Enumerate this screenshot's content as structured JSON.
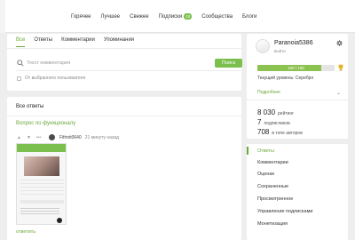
{
  "nav": {
    "items": [
      {
        "label": "Горячее"
      },
      {
        "label": "Лучшее"
      },
      {
        "label": "Свежее"
      },
      {
        "label": "Подписки",
        "badge": "18"
      },
      {
        "label": "Сообщества"
      },
      {
        "label": "Блоги"
      }
    ]
  },
  "tabs": [
    "Все",
    "Ответы",
    "Комментарии",
    "Упоминания"
  ],
  "search": {
    "placeholder": "Текст комментария",
    "button_label": "Поиск",
    "user_filter_label": "От выбранного пользователя"
  },
  "answers": {
    "header": "Все ответы",
    "question_title": "Вопрос по функционалу",
    "author": "Fifrinit0640",
    "time_ago": "21 минуту назад",
    "reply_label": "ответить"
  },
  "profile": {
    "username": "Paranoia5386",
    "logout_label": "выйти",
    "progress_text": "150 / 180",
    "progress_fraction": 0.8333,
    "level_text": "Текущий уровень: Серебро",
    "details_label": "Подробнее",
    "stats": [
      {
        "value": "8 030",
        "label": "рейтинг"
      },
      {
        "value": "7",
        "label": "подписчиков"
      },
      {
        "value": "708",
        "label": "в топе авторов"
      }
    ]
  },
  "menu": {
    "items": [
      {
        "label": "Ответы",
        "active": true
      },
      {
        "label": "Комментарии"
      },
      {
        "label": "Оценки"
      },
      {
        "label": "Сохраненные"
      },
      {
        "label": "Просмотренное"
      },
      {
        "label": "Управление подписками"
      },
      {
        "label": "Монетизация"
      }
    ]
  },
  "colors": {
    "accent": "#6aa83b",
    "button": "#7bbf4e",
    "progress": "#8cc24f"
  },
  "icons": [
    "search-icon",
    "gear-icon",
    "trophy-icon",
    "chevron-down-icon",
    "upvote-icon",
    "downvote-icon"
  ]
}
